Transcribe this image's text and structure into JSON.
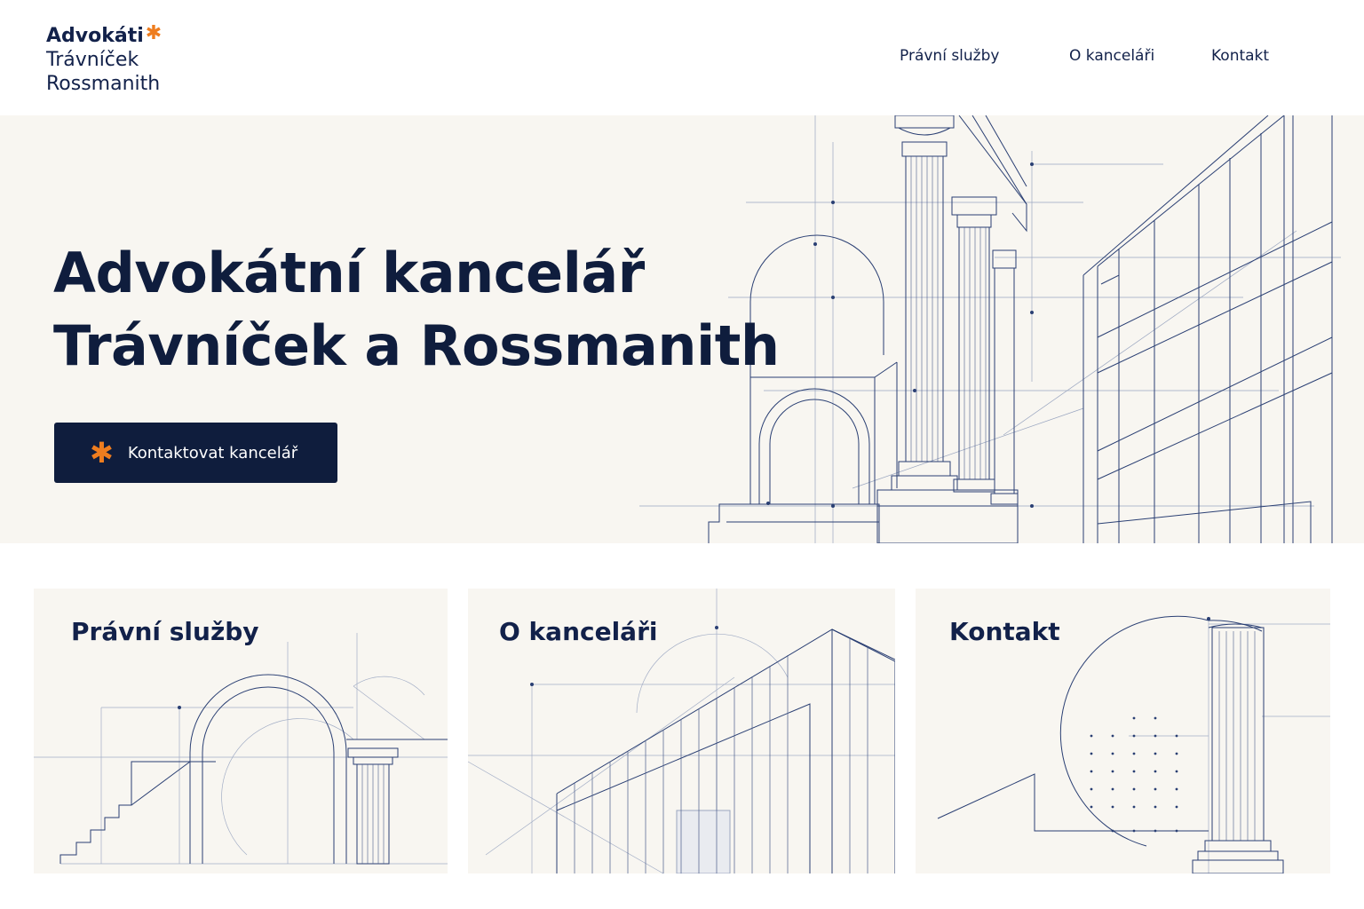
{
  "header": {
    "logo": {
      "line1": "Advokáti",
      "line2": "Trávníček",
      "line3": "Rossmanith"
    },
    "nav": [
      {
        "label": "Právní služby"
      },
      {
        "label": "O kanceláři"
      },
      {
        "label": "Kontakt"
      }
    ]
  },
  "hero": {
    "title_line1": "Advokátní kancelář",
    "title_line2": "Trávníček a Rossmanith",
    "cta_label": "Kontaktovat kancelář"
  },
  "cards": [
    {
      "title": "Právní služby"
    },
    {
      "title": "O kanceláři"
    },
    {
      "title": "Kontakt"
    }
  ],
  "colors": {
    "navy": "#0f1d3d",
    "accent": "#ee7d1f",
    "background": "#f8f6f1"
  },
  "icons": {
    "logo_accent": "asterisk-icon",
    "cta_accent": "asterisk-icon"
  }
}
